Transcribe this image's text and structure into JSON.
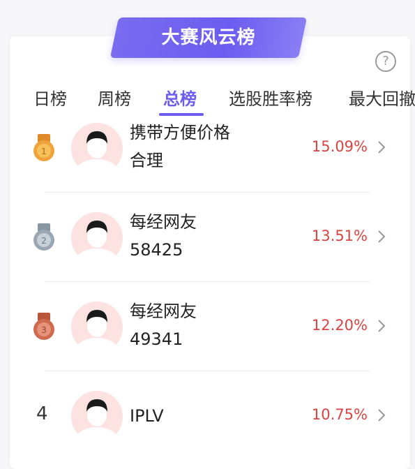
{
  "header": {
    "title": "大赛风云榜",
    "help_icon": "?"
  },
  "tabs": [
    {
      "label": "日榜"
    },
    {
      "label": "周榜"
    },
    {
      "label": "总榜",
      "active": true
    },
    {
      "label": "选股胜率榜"
    },
    {
      "label": "最大回撤"
    }
  ],
  "colors": {
    "accent": "#6c5cf0",
    "rate": "#d64542",
    "gold": "#f0a33a",
    "silver": "#9aa6b2",
    "bronze": "#cf6a4c"
  },
  "ranking": [
    {
      "rank": "1",
      "medal": "gold-medal-icon",
      "name_line1": "携带方便价格",
      "name_line2": "合理",
      "rate": "15.09%"
    },
    {
      "rank": "2",
      "medal": "silver-medal-icon",
      "name_line1": "每经网友",
      "name_line2": "58425",
      "rate": "13.51%"
    },
    {
      "rank": "3",
      "medal": "bronze-medal-icon",
      "name_line1": "每经网友",
      "name_line2": "49341",
      "rate": "12.20%"
    },
    {
      "rank": "4",
      "medal": "",
      "name_line1": "IPLV",
      "name_line2": "",
      "rate": "10.75%"
    }
  ]
}
